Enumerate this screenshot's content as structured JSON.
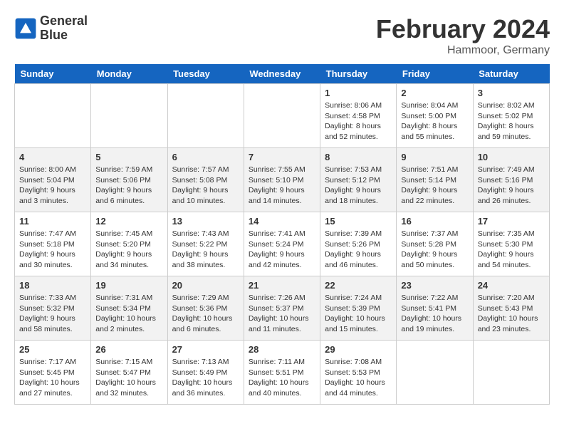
{
  "header": {
    "logo_line1": "General",
    "logo_line2": "Blue",
    "title": "February 2024",
    "subtitle": "Hammoor, Germany"
  },
  "calendar": {
    "days_of_week": [
      "Sunday",
      "Monday",
      "Tuesday",
      "Wednesday",
      "Thursday",
      "Friday",
      "Saturday"
    ],
    "weeks": [
      [
        {
          "day": "",
          "empty": true
        },
        {
          "day": "",
          "empty": true
        },
        {
          "day": "",
          "empty": true
        },
        {
          "day": "",
          "empty": true
        },
        {
          "day": "1",
          "sunrise": "8:06 AM",
          "sunset": "4:58 PM",
          "daylight": "8 hours and 52 minutes."
        },
        {
          "day": "2",
          "sunrise": "8:04 AM",
          "sunset": "5:00 PM",
          "daylight": "8 hours and 55 minutes."
        },
        {
          "day": "3",
          "sunrise": "8:02 AM",
          "sunset": "5:02 PM",
          "daylight": "8 hours and 59 minutes."
        }
      ],
      [
        {
          "day": "4",
          "sunrise": "8:00 AM",
          "sunset": "5:04 PM",
          "daylight": "9 hours and 3 minutes."
        },
        {
          "day": "5",
          "sunrise": "7:59 AM",
          "sunset": "5:06 PM",
          "daylight": "9 hours and 6 minutes."
        },
        {
          "day": "6",
          "sunrise": "7:57 AM",
          "sunset": "5:08 PM",
          "daylight": "9 hours and 10 minutes."
        },
        {
          "day": "7",
          "sunrise": "7:55 AM",
          "sunset": "5:10 PM",
          "daylight": "9 hours and 14 minutes."
        },
        {
          "day": "8",
          "sunrise": "7:53 AM",
          "sunset": "5:12 PM",
          "daylight": "9 hours and 18 minutes."
        },
        {
          "day": "9",
          "sunrise": "7:51 AM",
          "sunset": "5:14 PM",
          "daylight": "9 hours and 22 minutes."
        },
        {
          "day": "10",
          "sunrise": "7:49 AM",
          "sunset": "5:16 PM",
          "daylight": "9 hours and 26 minutes."
        }
      ],
      [
        {
          "day": "11",
          "sunrise": "7:47 AM",
          "sunset": "5:18 PM",
          "daylight": "9 hours and 30 minutes."
        },
        {
          "day": "12",
          "sunrise": "7:45 AM",
          "sunset": "5:20 PM",
          "daylight": "9 hours and 34 minutes."
        },
        {
          "day": "13",
          "sunrise": "7:43 AM",
          "sunset": "5:22 PM",
          "daylight": "9 hours and 38 minutes."
        },
        {
          "day": "14",
          "sunrise": "7:41 AM",
          "sunset": "5:24 PM",
          "daylight": "9 hours and 42 minutes."
        },
        {
          "day": "15",
          "sunrise": "7:39 AM",
          "sunset": "5:26 PM",
          "daylight": "9 hours and 46 minutes."
        },
        {
          "day": "16",
          "sunrise": "7:37 AM",
          "sunset": "5:28 PM",
          "daylight": "9 hours and 50 minutes."
        },
        {
          "day": "17",
          "sunrise": "7:35 AM",
          "sunset": "5:30 PM",
          "daylight": "9 hours and 54 minutes."
        }
      ],
      [
        {
          "day": "18",
          "sunrise": "7:33 AM",
          "sunset": "5:32 PM",
          "daylight": "9 hours and 58 minutes."
        },
        {
          "day": "19",
          "sunrise": "7:31 AM",
          "sunset": "5:34 PM",
          "daylight": "10 hours and 2 minutes."
        },
        {
          "day": "20",
          "sunrise": "7:29 AM",
          "sunset": "5:36 PM",
          "daylight": "10 hours and 6 minutes."
        },
        {
          "day": "21",
          "sunrise": "7:26 AM",
          "sunset": "5:37 PM",
          "daylight": "10 hours and 11 minutes."
        },
        {
          "day": "22",
          "sunrise": "7:24 AM",
          "sunset": "5:39 PM",
          "daylight": "10 hours and 15 minutes."
        },
        {
          "day": "23",
          "sunrise": "7:22 AM",
          "sunset": "5:41 PM",
          "daylight": "10 hours and 19 minutes."
        },
        {
          "day": "24",
          "sunrise": "7:20 AM",
          "sunset": "5:43 PM",
          "daylight": "10 hours and 23 minutes."
        }
      ],
      [
        {
          "day": "25",
          "sunrise": "7:17 AM",
          "sunset": "5:45 PM",
          "daylight": "10 hours and 27 minutes."
        },
        {
          "day": "26",
          "sunrise": "7:15 AM",
          "sunset": "5:47 PM",
          "daylight": "10 hours and 32 minutes."
        },
        {
          "day": "27",
          "sunrise": "7:13 AM",
          "sunset": "5:49 PM",
          "daylight": "10 hours and 36 minutes."
        },
        {
          "day": "28",
          "sunrise": "7:11 AM",
          "sunset": "5:51 PM",
          "daylight": "10 hours and 40 minutes."
        },
        {
          "day": "29",
          "sunrise": "7:08 AM",
          "sunset": "5:53 PM",
          "daylight": "10 hours and 44 minutes."
        },
        {
          "day": "",
          "empty": true
        },
        {
          "day": "",
          "empty": true
        }
      ]
    ]
  }
}
